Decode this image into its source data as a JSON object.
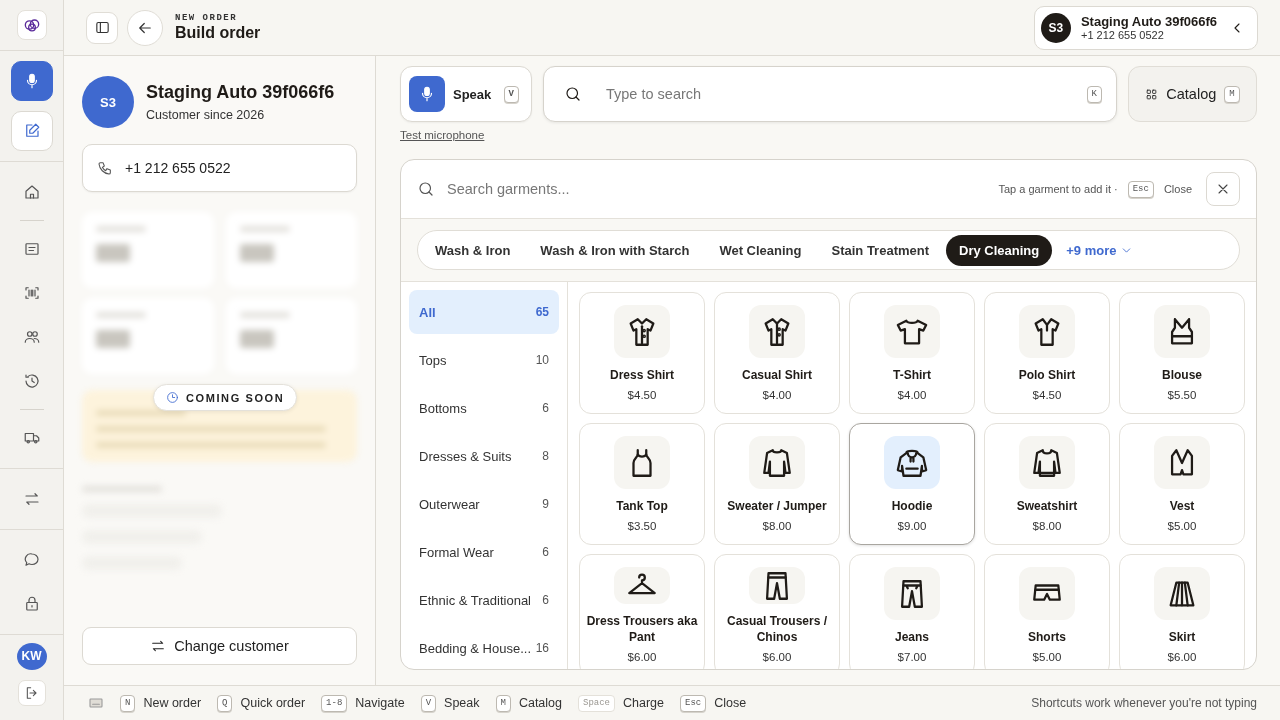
{
  "sidebar": {
    "quick_actions": [
      {
        "selected": true
      },
      {
        "selected": false
      }
    ],
    "user_initials": "KW"
  },
  "header": {
    "eyebrow": "NEW ORDER",
    "title": "Build order",
    "customer_chip": {
      "initials": "S3",
      "name": "Staging Auto 39f066f6",
      "phone": "+1 212 655 0522"
    }
  },
  "customer": {
    "initials": "S3",
    "name": "Staging Auto 39f066f6",
    "since": "Customer since 2026",
    "phone": "+1 212 655 0522",
    "badge": "COMING SOON",
    "change_button": "Change customer"
  },
  "order": {
    "speak": {
      "label": "Speak",
      "key": "V"
    },
    "search": {
      "placeholder": "Type to search",
      "key": "K"
    },
    "catalog": {
      "label": "Catalog",
      "key": "M"
    },
    "test_link": "Test microphone"
  },
  "picker": {
    "search_placeholder": "Search garments...",
    "hint": "Tap a garment to add it ·",
    "hint_key": "Esc",
    "hint_action": "Close",
    "services": [
      {
        "label": "Wash & Iron",
        "selected": false
      },
      {
        "label": "Wash & Iron with Starch",
        "selected": false
      },
      {
        "label": "Wet Cleaning",
        "selected": false
      },
      {
        "label": "Stain Treatment",
        "selected": false
      },
      {
        "label": "Dry Cleaning",
        "selected": true
      }
    ],
    "more": "+9 more",
    "categories": [
      {
        "name": "All",
        "count": "65",
        "selected": true
      },
      {
        "name": "Tops",
        "count": "10",
        "selected": false
      },
      {
        "name": "Bottoms",
        "count": "6",
        "selected": false
      },
      {
        "name": "Dresses & Suits",
        "count": "8",
        "selected": false
      },
      {
        "name": "Outerwear",
        "count": "9",
        "selected": false
      },
      {
        "name": "Formal Wear",
        "count": "6",
        "selected": false
      },
      {
        "name": "Ethnic & Traditional",
        "count": "6",
        "selected": false
      },
      {
        "name": "Bedding & House...",
        "count": "16",
        "selected": false
      }
    ],
    "garments": [
      {
        "name": "Dress Shirt",
        "price": "$4.50",
        "selected": false
      },
      {
        "name": "Casual Shirt",
        "price": "$4.00",
        "selected": false
      },
      {
        "name": "T-Shirt",
        "price": "$4.00",
        "selected": false
      },
      {
        "name": "Polo Shirt",
        "price": "$4.50",
        "selected": false
      },
      {
        "name": "Blouse",
        "price": "$5.50",
        "selected": false
      },
      {
        "name": "Tank Top",
        "price": "$3.50",
        "selected": false
      },
      {
        "name": "Sweater / Jumper",
        "price": "$8.00",
        "selected": false
      },
      {
        "name": "Hoodie",
        "price": "$9.00",
        "selected": true
      },
      {
        "name": "Sweatshirt",
        "price": "$8.00",
        "selected": false
      },
      {
        "name": "Vest",
        "price": "$5.00",
        "selected": false
      },
      {
        "name": "Dress Trousers aka Pant",
        "price": "$6.00",
        "selected": false
      },
      {
        "name": "Casual Trousers / Chinos",
        "price": "$6.00",
        "selected": false
      },
      {
        "name": "Jeans",
        "price": "$7.00",
        "selected": false
      },
      {
        "name": "Shorts",
        "price": "$5.00",
        "selected": false
      },
      {
        "name": "Skirt",
        "price": "$6.00",
        "selected": false
      }
    ]
  },
  "shortcuts": {
    "items": [
      {
        "key": "N",
        "label": "New order",
        "disabled": false
      },
      {
        "key": "Q",
        "label": "Quick order",
        "disabled": false
      },
      {
        "key": "1-8",
        "label": "Navigate",
        "disabled": false
      },
      {
        "key": "V",
        "label": "Speak",
        "disabled": false
      },
      {
        "key": "M",
        "label": "Catalog",
        "disabled": false
      },
      {
        "key": "Space",
        "label": "Charge",
        "disabled": true
      },
      {
        "key": "Esc",
        "label": "Close",
        "disabled": false
      }
    ],
    "note": "Shortcuts work whenever you're not typing"
  }
}
